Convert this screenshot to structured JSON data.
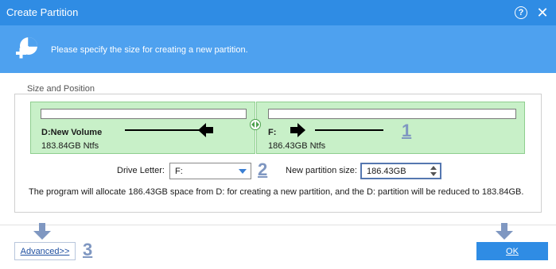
{
  "window": {
    "title": "Create Partition",
    "help_icon": "help-icon",
    "close_icon": "close-icon",
    "help_glyph": "?",
    "close_glyph": "✕"
  },
  "banner": {
    "icon": "partition-add-icon",
    "text": "Please specify the size for creating a new partition."
  },
  "size_position": {
    "group_label": "Size and Position",
    "left_partition": {
      "name": "D:New Volume",
      "info": "183.84GB Ntfs"
    },
    "right_partition": {
      "name": "F:",
      "info": "186.43GB Ntfs"
    }
  },
  "callouts": [
    "1",
    "2",
    "3"
  ],
  "drive_letter": {
    "label": "Drive Letter:",
    "value": "F:"
  },
  "new_size": {
    "label": "New partition size:",
    "value": "186.43GB"
  },
  "info_text": "The program will allocate 186.43GB space from D: for creating a new partition, and the D: partition will be reduced to 183.84GB.",
  "buttons": {
    "advanced": "Advanced>>",
    "ok": "OK"
  },
  "colors": {
    "title_bar": "#2f8ce4",
    "banner": "#4ea1ef",
    "partition_fill": "#c8f0c8",
    "callout": "#7f97c1"
  }
}
